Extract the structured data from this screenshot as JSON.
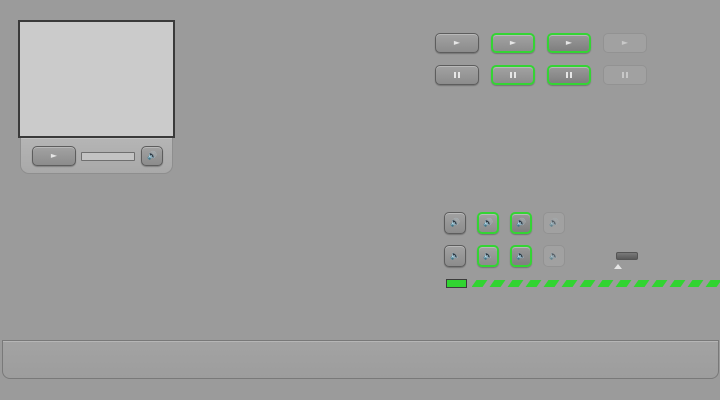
{
  "colors": {
    "background": "#9b9b9b",
    "accent_green": "#34d434"
  },
  "player": {
    "play_icon": "play-icon",
    "volume_icon": "speaker-icon",
    "progress": 0
  },
  "button_states": [
    "normal",
    "hover",
    "active",
    "disabled"
  ],
  "sprite_rows": [
    {
      "name": "play",
      "icon": "play-icon"
    },
    {
      "name": "pause",
      "icon": "pause-icon"
    },
    {
      "name": "volume",
      "icon": "speaker-icon"
    },
    {
      "name": "mute",
      "icon": "speaker-muted-icon"
    }
  ],
  "volume_level": 0.1
}
